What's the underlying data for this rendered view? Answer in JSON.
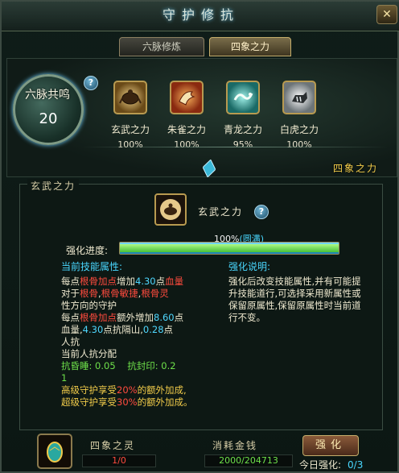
{
  "window": {
    "title": "守护修抗",
    "close_label": "✕"
  },
  "tabs": [
    {
      "label": "六脉修炼",
      "active": false
    },
    {
      "label": "四象之力",
      "active": true
    }
  ],
  "resonance": {
    "label": "六脉共鸣",
    "level": "20",
    "help": "?"
  },
  "beasts": [
    {
      "name": "玄武之力",
      "percent": "100%",
      "icon": "tortoise-icon",
      "color": "#c89a3a"
    },
    {
      "name": "朱雀之力",
      "percent": "100%",
      "icon": "vermilion-bird-icon",
      "color": "#d46a2a"
    },
    {
      "name": "青龙之力",
      "percent": "95%",
      "icon": "azure-dragon-icon",
      "color": "#2ab0a8"
    },
    {
      "name": "白虎之力",
      "percent": "100%",
      "icon": "white-tiger-icon",
      "color": "#b8c4c8"
    }
  ],
  "sixiang_tag": "四象之力",
  "section": {
    "title": "玄武之力",
    "skill_name": "玄武之力",
    "help": "?",
    "progress_label": "强化进度:",
    "progress_value": "100%",
    "progress_status": "(圆满)",
    "progress_fraction": 1.0,
    "attr_header": "当前技能属性:",
    "expl_header": "强化说明:",
    "attr_lines": {
      "l1a": "每点",
      "l1b": "根骨加点",
      "l1c": "增加",
      "l1d": "4.30",
      "l1e": "点",
      "l1f": "血量",
      "l2a": "对于",
      "l2b": "根骨",
      "l2c": ",",
      "l2d": "根骨敏捷",
      "l2e": ",",
      "l2f": "根骨灵",
      "l3": "性方向的守护",
      "l4a": "每点",
      "l4b": "根骨加点",
      "l4c": "额外增加",
      "l4d": "8.60",
      "l4e": "点",
      "l5a": "血量",
      "l5b": ",",
      "l5c": "4.30",
      "l5d": "点抗隔山",
      "l5e": ",",
      "l5f": "0.28",
      "l5g": "点",
      "l6": "人抗",
      "l7": "当前人抗分配",
      "l8a": "抗昏睡",
      "l8b": ": 0.05",
      "l8c": "抗封印",
      "l8d": ": 0.2",
      "l9": "1",
      "l10a": "高级守护享受",
      "l10b": "20%",
      "l10c": "的额外加成,",
      "l11a": "超级守护享受",
      "l11b": "30%",
      "l11c": "的额外加成。"
    },
    "explanation": "强化后改变技能属性,并有可能提升技能道行,可选择采用新属性或保留原属性,保留原属性时当前道行不变。"
  },
  "bottom": {
    "spirit_label": "四象之灵",
    "spirit_value": "1/0",
    "money_label": "消耗金钱",
    "money_value": "2000/204713",
    "strengthen_label": "强化",
    "today_label": "今日强化:",
    "today_value": "0/3"
  }
}
